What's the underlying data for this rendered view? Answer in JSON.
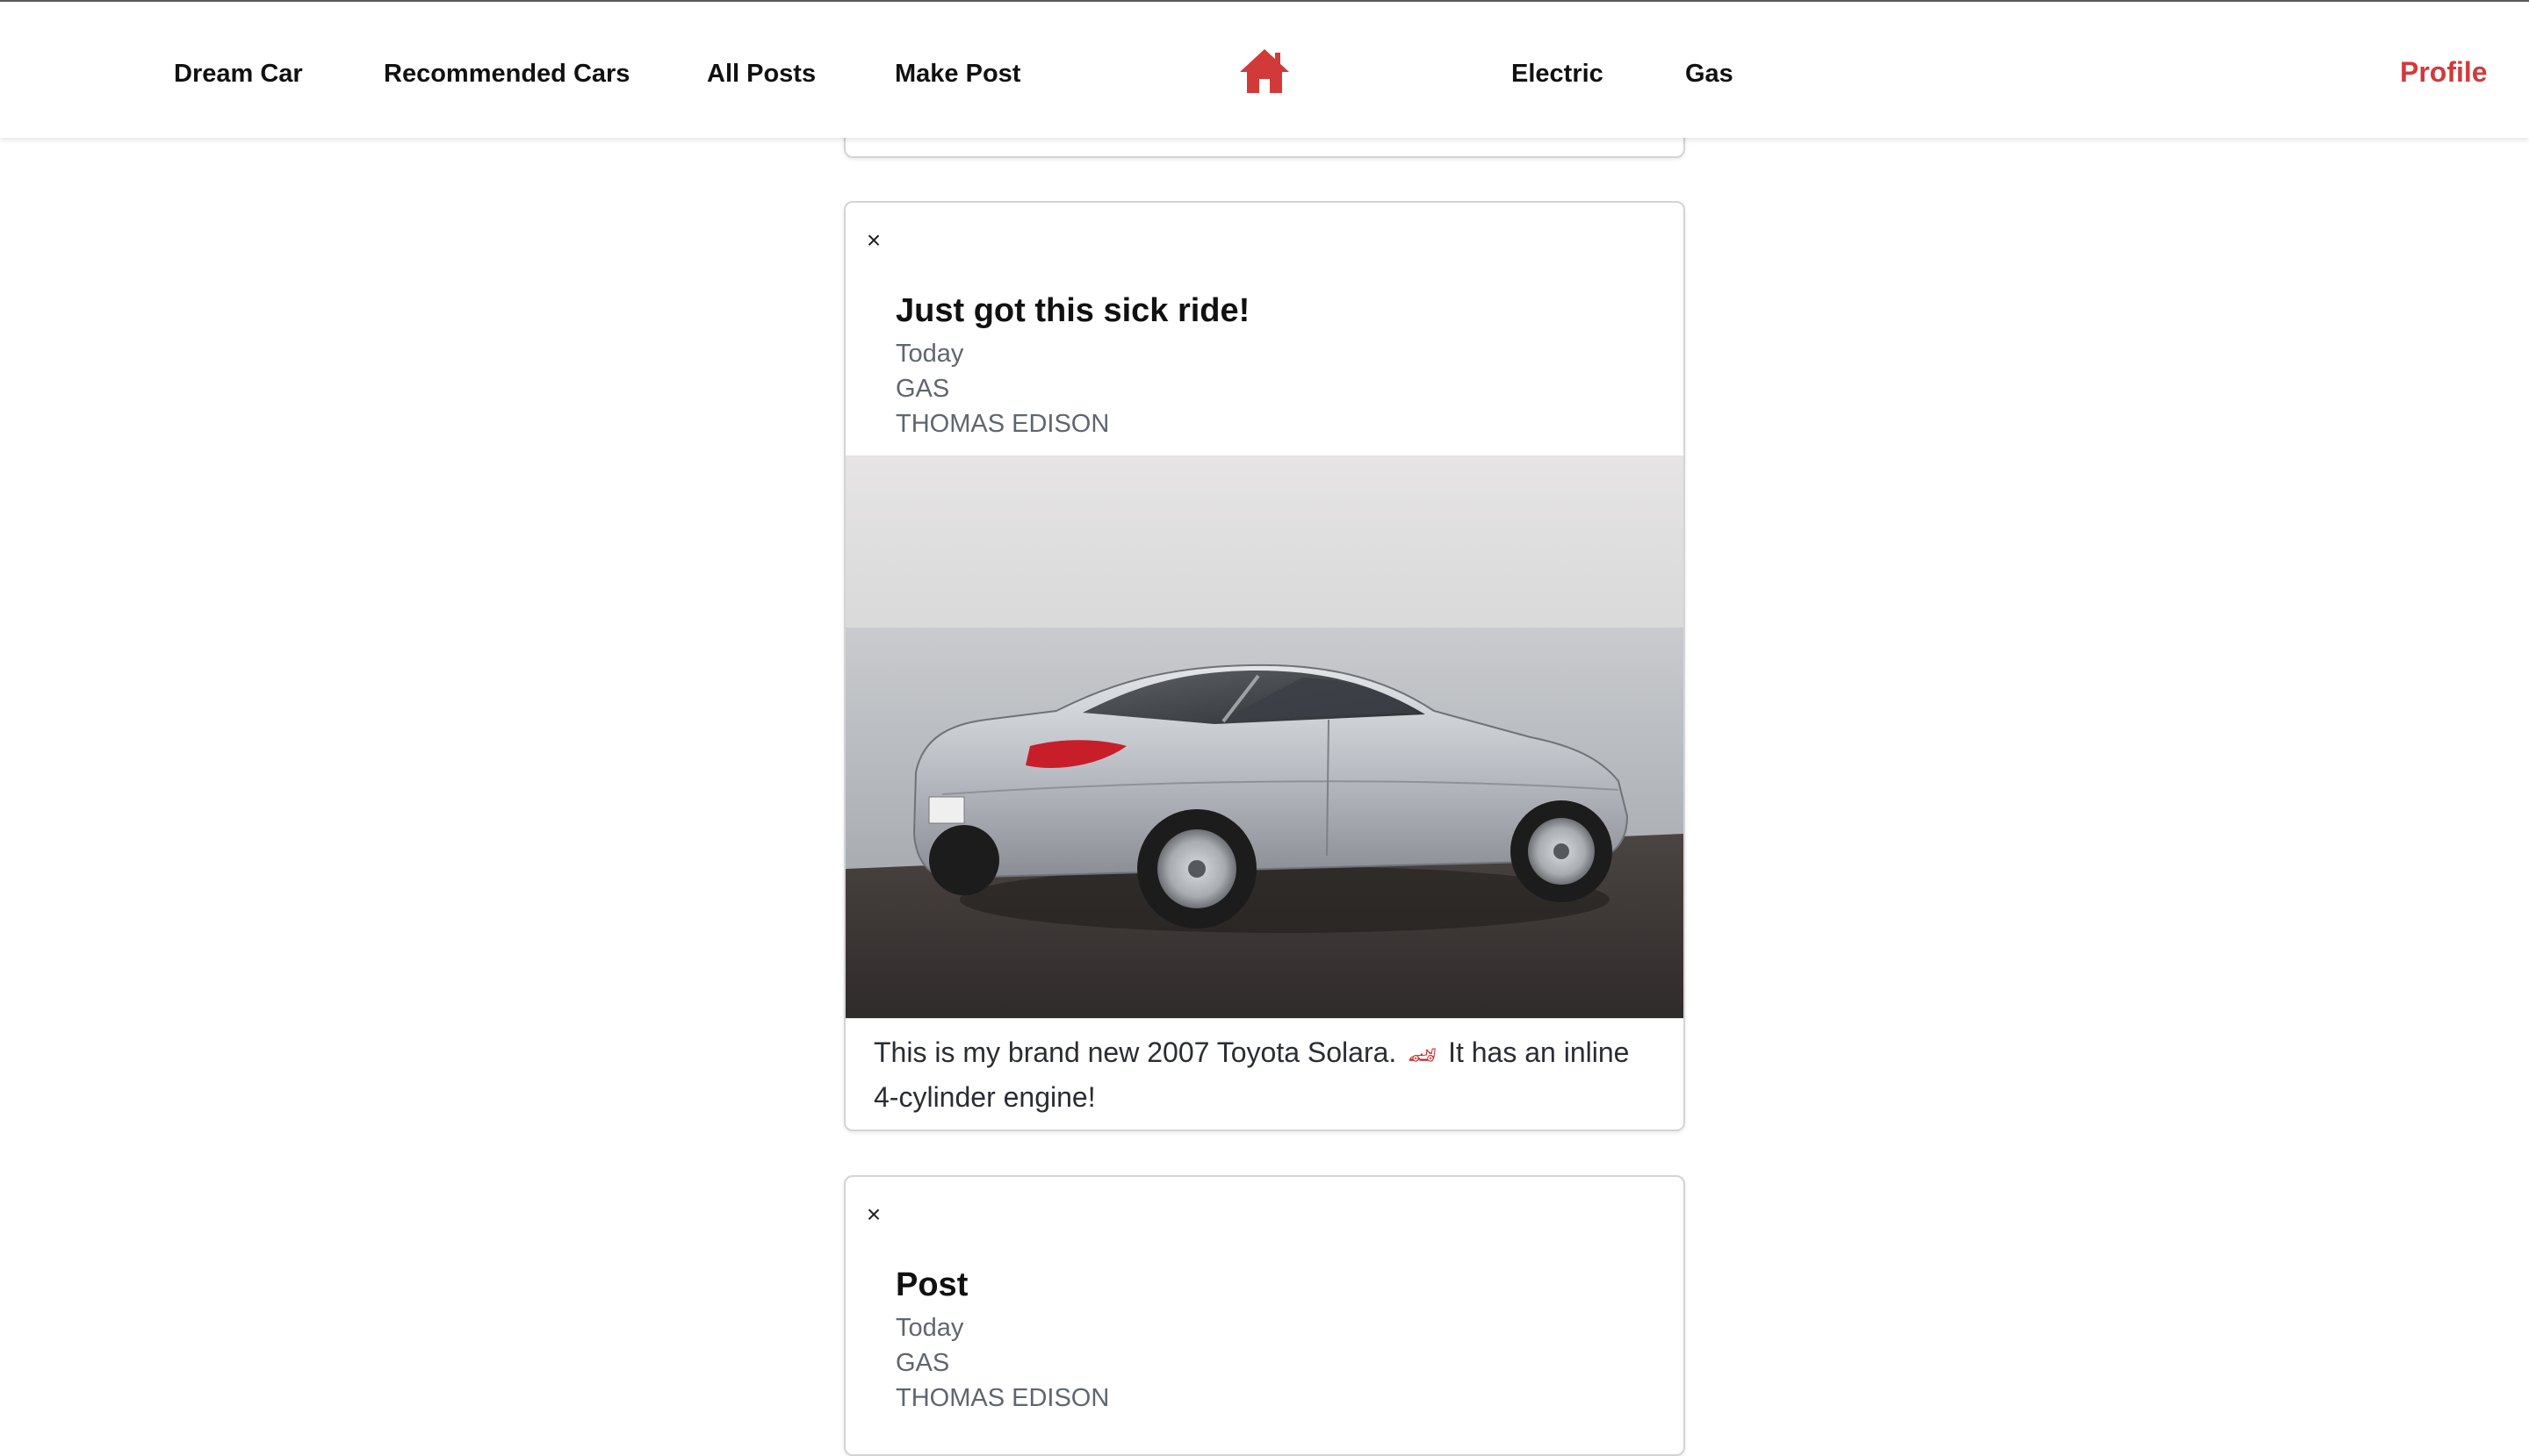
{
  "nav": {
    "dream_car": "Dream Car",
    "recommended_cars": "Recommended Cars",
    "all_posts": "All Posts",
    "make_post": "Make Post",
    "home_icon": "home-icon",
    "electric": "Electric",
    "gas": "Gas",
    "profile": "Profile",
    "accent_color": "#d23a3a"
  },
  "posts": [
    {
      "close": "×",
      "title": "Just got this sick ride!",
      "date": "Today",
      "fuel_type": "GAS",
      "author": "THOMAS EDISON",
      "body_before": "This is my brand new 2007 Toyota Solara.",
      "emoji_icon": "race-car-icon",
      "body_after": "It has an inline 4-cylinder engine!"
    },
    {
      "close": "×",
      "title": "Post",
      "date": "Today",
      "fuel_type": "GAS",
      "author": "THOMAS EDISON"
    }
  ]
}
